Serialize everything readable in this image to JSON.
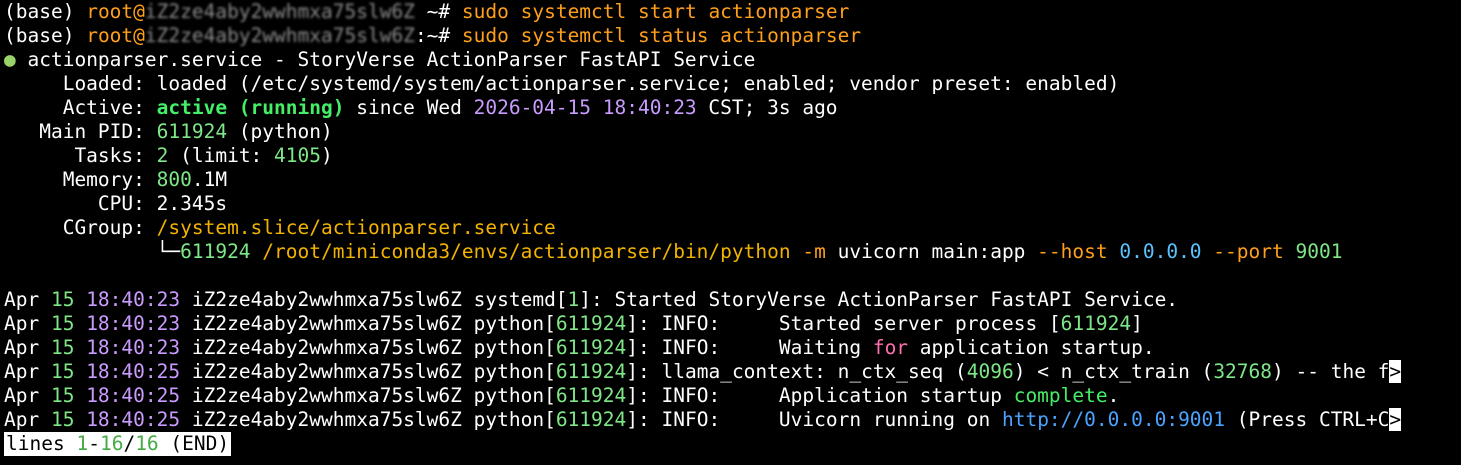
{
  "prompt": {
    "env": "(base)",
    "user": "root@",
    "host1": "iZ2ze4aby2wwhmxa75slw6Z",
    "suffix1": " ~# ",
    "cmd1": "sudo systemctl start actionparser",
    "host2": "iZ2ze4aby2wwhmxa75slw6Z",
    "suffix2": ":~# ",
    "cmd2": "sudo systemctl status actionparser"
  },
  "service": {
    "dot": "●",
    "unit_line": " actionparser.service - StoryVerse ActionParser FastAPI Service",
    "loaded_label": "     Loaded: ",
    "loaded_value": "loaded (/etc/systemd/system/actionparser.service; enabled; vendor preset: enabled)",
    "active_label": "     Active: ",
    "active_state": "active (running)",
    "active_since": " since Wed ",
    "active_time": "2026-04-15 18:40:23",
    "active_rest": " CST; 3s ago",
    "pid_label": "   Main PID: ",
    "pid_value": "611924",
    "pid_rest": " (python)",
    "tasks_label": "      Tasks: ",
    "tasks_value": "2",
    "tasks_mid": " (limit: ",
    "tasks_limit": "4105",
    "tasks_end": ")",
    "memory_label": "     Memory: ",
    "memory_num": "800",
    "memory_unit": ".1M",
    "cpu_label": "        CPU: ",
    "cpu_value": "2.345s",
    "cgroup_label": "     CGroup: ",
    "cgroup_value": "/system.slice/actionparser.service",
    "tree_prefix": "             └─",
    "tree_pid": "611924",
    "tree_path": " /root/miniconda3/envs/actionparser/bin/python",
    "tree_m": " -m",
    "tree_mid": " uvicorn main:app ",
    "tree_host_flag": "--host",
    "tree_host_val": " 0.0.0.0",
    "tree_port_flag": " --port",
    "tree_port_val": " 9001"
  },
  "logs": [
    {
      "month": "Apr ",
      "day": "15",
      "time": " 18:40:23",
      "host": " iZ2ze4aby2wwhmxa75slw6Z ",
      "proc": "systemd[",
      "pid": "1",
      "proc_end": "]: ",
      "msg_a": "Started StoryVerse ActionParser FastAPI Service.",
      "msg_hl": "",
      "msg_b": "",
      "msg_hl2": "",
      "msg_c": "",
      "truncated": false
    },
    {
      "month": "Apr ",
      "day": "15",
      "time": " 18:40:23",
      "host": " iZ2ze4aby2wwhmxa75slw6Z ",
      "proc": "python[",
      "pid": "611924",
      "proc_end": "]: ",
      "msg_a": "INFO:     Started server process [",
      "msg_hl": "611924",
      "msg_b": "]",
      "msg_hl2": "",
      "msg_c": "",
      "truncated": false
    },
    {
      "month": "Apr ",
      "day": "15",
      "time": " 18:40:23",
      "host": " iZ2ze4aby2wwhmxa75slw6Z ",
      "proc": "python[",
      "pid": "611924",
      "proc_end": "]: ",
      "msg_a": "INFO:     Waiting ",
      "msg_hl": "for",
      "msg_b": " application startup.",
      "msg_hl2": "",
      "msg_c": "",
      "truncated": false
    },
    {
      "month": "Apr ",
      "day": "15",
      "time": " 18:40:25",
      "host": " iZ2ze4aby2wwhmxa75slw6Z ",
      "proc": "python[",
      "pid": "611924",
      "proc_end": "]: ",
      "msg_a": "llama_context: n_ctx_seq (",
      "msg_hl": "4096",
      "msg_b": ") < n_ctx_train (",
      "msg_hl2": "32768",
      "msg_c": ") -- the f",
      "truncated": true
    },
    {
      "month": "Apr ",
      "day": "15",
      "time": " 18:40:25",
      "host": " iZ2ze4aby2wwhmxa75slw6Z ",
      "proc": "python[",
      "pid": "611924",
      "proc_end": "]: ",
      "msg_a": "INFO:     Application startup ",
      "msg_hl": "complete",
      "msg_b": ".",
      "msg_hl2": "",
      "msg_c": "",
      "truncated": false
    },
    {
      "month": "Apr ",
      "day": "15",
      "time": " 18:40:25",
      "host": " iZ2ze4aby2wwhmxa75slw6Z ",
      "proc": "python[",
      "pid": "611924",
      "proc_end": "]: ",
      "msg_a": "INFO:     Uvicorn running on ",
      "msg_hl": "http://0.0.0.0:9001",
      "msg_b": " (Press CTRL+C",
      "msg_hl2": "",
      "msg_c": "",
      "truncated": true
    }
  ],
  "trunc_marker": ">",
  "pager": {
    "prefix": "lines ",
    "start": "1",
    "sep": "-",
    "end": "16",
    "slash": "/",
    "total": "16",
    "suffix": " (END)"
  },
  "colors": {
    "background": "#000000",
    "prompt_user": "#ff9f1a",
    "active_green": "#44ee66",
    "number_green": "#7ee787",
    "timestamp_purple": "#c99bff",
    "keyword_pink": "#ff6fb0",
    "url_blue": "#4aa3ff",
    "path_gold": "#f2b300"
  }
}
